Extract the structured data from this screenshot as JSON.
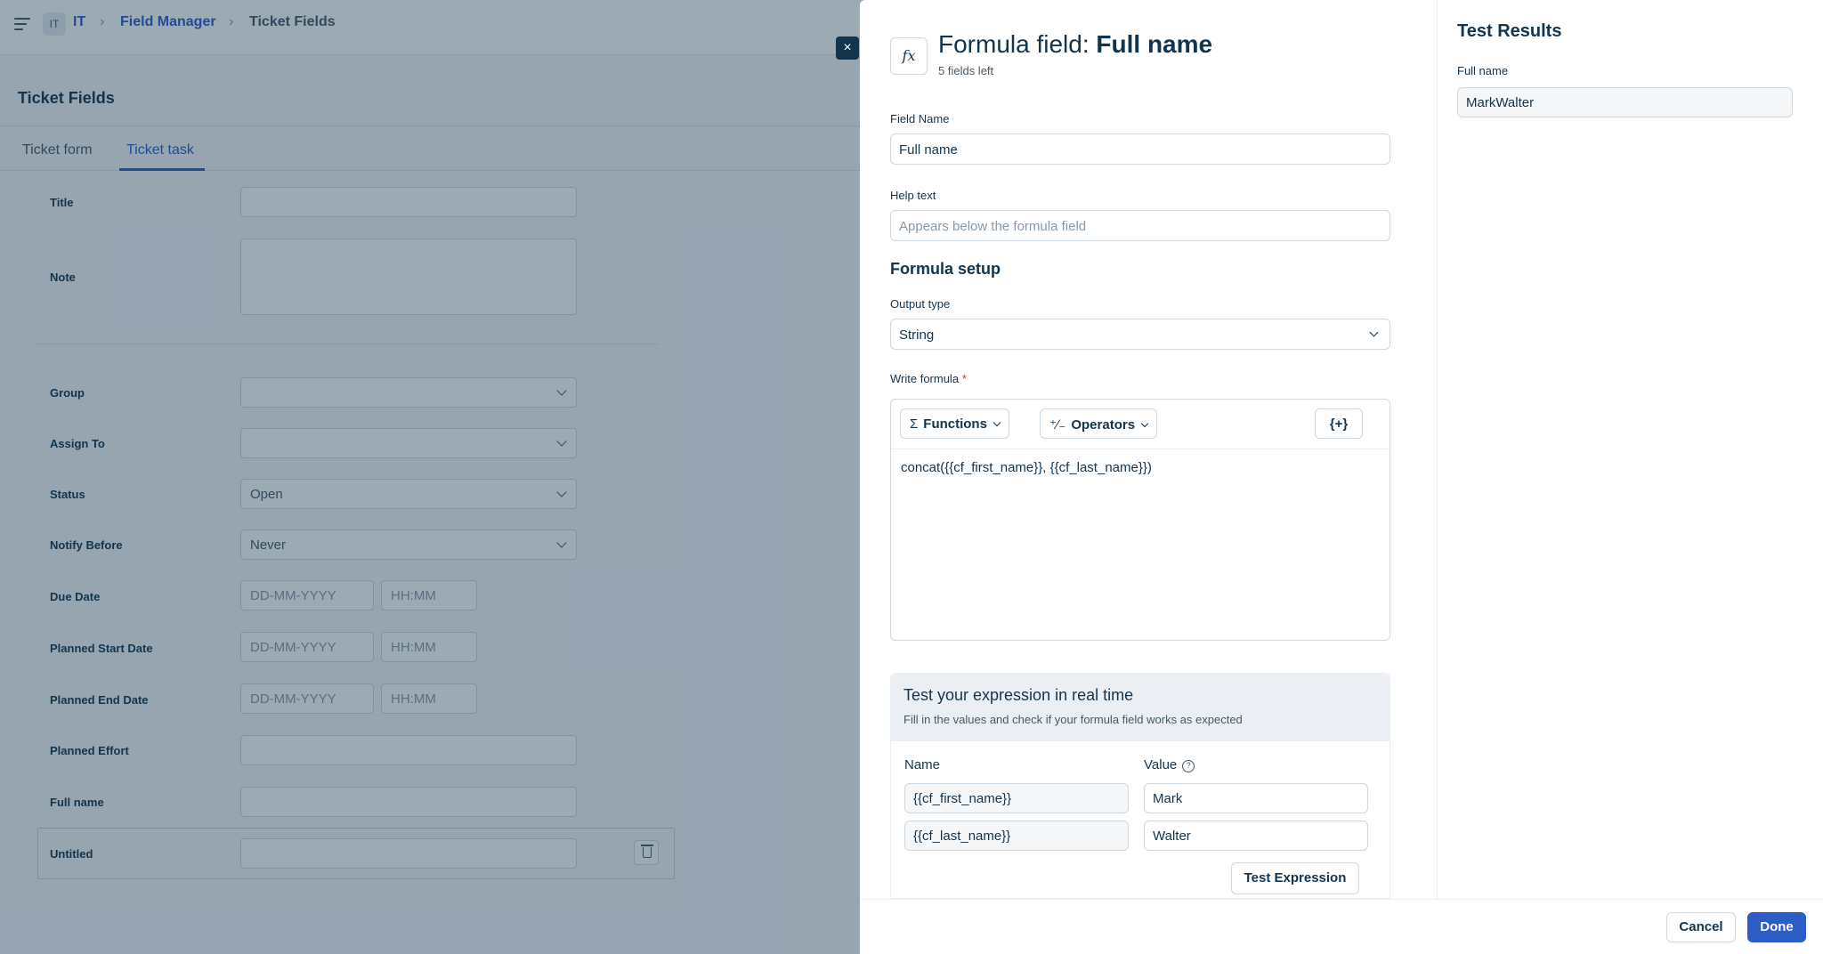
{
  "breadcrumb": {
    "workspace_badge": "IT",
    "workspace": "IT",
    "field_manager": "Field Manager",
    "current": "Ticket Fields"
  },
  "page": {
    "title": "Ticket Fields",
    "tabs": [
      "Ticket form",
      "Ticket task"
    ],
    "active_tab": "Ticket task"
  },
  "form_rows": {
    "title": "Title",
    "note": "Note",
    "group": "Group",
    "assign_to": "Assign To",
    "status": "Status",
    "status_value": "Open",
    "notify_before": "Notify Before",
    "notify_value": "Never",
    "due_date": "Due Date",
    "planned_start": "Planned Start Date",
    "planned_end": "Planned End Date",
    "planned_effort": "Planned Effort",
    "full_name": "Full name",
    "untitled": "Untitled",
    "date_placeholder": "DD-MM-YYYY",
    "time_placeholder": "HH:MM"
  },
  "drawer": {
    "close_symbol": "×",
    "fx_symbol": "fx",
    "title_prefix": "Formula field:",
    "title_name": "Full name",
    "subtitle": "5 fields left",
    "field_name_label": "Field Name",
    "field_name_value": "Full name",
    "help_text_label": "Help text",
    "help_text_placeholder": "Appears below the formula field",
    "formula_setup": "Formula setup",
    "output_type_label": "Output type",
    "output_type_value": "String",
    "write_formula_label": "Write formula",
    "required_mark": "*",
    "functions_icon": "Σ",
    "functions_label": "Functions",
    "operators_icon": "⁺∕₋",
    "operators_label": "Operators",
    "placeholder_btn": "{+}",
    "formula": "concat({{cf_first_name}}, {{cf_last_name}})",
    "test": {
      "title": "Test your expression in real time",
      "subtitle": "Fill in the values and check if your formula field works as expected",
      "name_header": "Name",
      "value_header": "Value",
      "help_symbol": "?",
      "rows": [
        {
          "name": "{{cf_first_name}}",
          "value": "Mark"
        },
        {
          "name": "{{cf_last_name}}",
          "value": "Walter"
        }
      ],
      "button": "Test Expression"
    }
  },
  "results": {
    "title": "Test Results",
    "label": "Full name",
    "value": "MarkWalter"
  },
  "footer": {
    "cancel": "Cancel",
    "done": "Done"
  },
  "colors": {
    "accent": "#2c5cc5",
    "text": "#12344d",
    "overlay": "rgba(18,52,77,0.42)"
  }
}
